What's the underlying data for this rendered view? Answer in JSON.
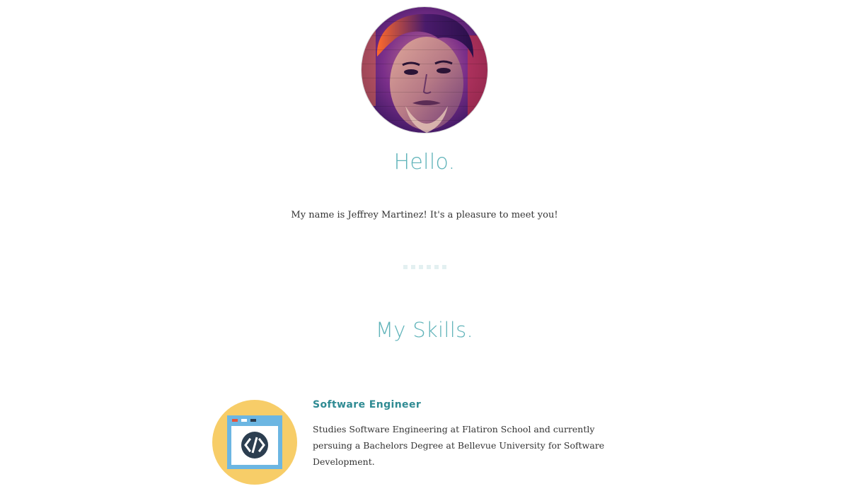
{
  "profile": {
    "avatar_alt": "Jeffrey Martinez portrait",
    "greeting": "Hello.",
    "intro": "My name is Jeffrey Martinez! It's a pleasure to meet you!"
  },
  "skills": {
    "heading": "My Skills.",
    "items": [
      {
        "icon": "code-window-icon",
        "title": "Software Engineer",
        "description": "Studies Software Engineering at Flatiron School and currently persuing a Bachelors Degree at Bellevue University for Software Development."
      }
    ]
  },
  "colors": {
    "accent": "#5fb3b9",
    "accent_dark": "#2f8b93",
    "icon_circle": "#f7cd68",
    "divider": "#e3f0f1"
  }
}
